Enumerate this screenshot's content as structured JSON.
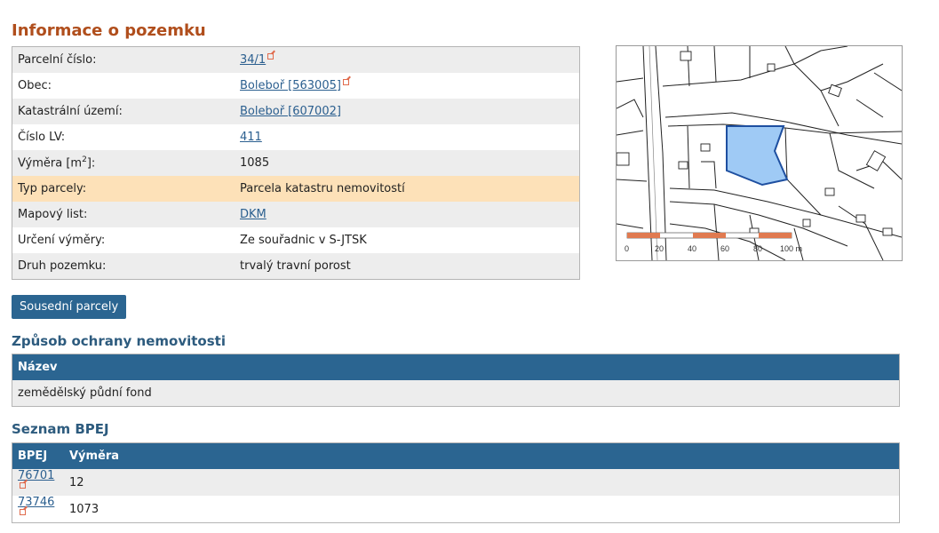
{
  "page": {
    "title": "Informace o pozemku"
  },
  "info_rows": [
    {
      "label": "Parcelní číslo:",
      "value": "34/1",
      "link": true,
      "external": true
    },
    {
      "label": "Obec:",
      "value": "Boleboř [563005]",
      "link": true,
      "external": true
    },
    {
      "label": "Katastrální území:",
      "value": "Boleboř [607002]",
      "link": true,
      "external": false
    },
    {
      "label": "Číslo LV:",
      "value": "411",
      "link": true,
      "external": false
    },
    {
      "label_main": "Výměra [m",
      "label_sup": "2",
      "label_tail": "]:",
      "value": "1085",
      "link": false
    },
    {
      "label": "Typ parcely:",
      "value": "Parcela katastru nemovitostí",
      "link": false,
      "highlight": true
    },
    {
      "label": "Mapový list:",
      "value": "DKM",
      "link": true,
      "external": false
    },
    {
      "label": "Určení výměry:",
      "value": "Ze souřadnic v S-JTSK",
      "link": false
    },
    {
      "label": "Druh pozemku:",
      "value": "trvalý travní porost",
      "link": false
    }
  ],
  "buttons": {
    "neighbors": "Sousední parcely"
  },
  "protection": {
    "title": "Způsob ochrany nemovitosti",
    "header": "Název",
    "rows": [
      "zemědělský půdní fond"
    ]
  },
  "bpej": {
    "title": "Seznam BPEJ",
    "headers": [
      "BPEJ",
      "Výměra"
    ],
    "rows": [
      {
        "code": "76701",
        "area": "12"
      },
      {
        "code": "73746",
        "area": "1073"
      }
    ]
  },
  "map": {
    "scale_labels": [
      "0",
      "20",
      "40",
      "60",
      "80",
      "100 m"
    ],
    "parcel_color": "#9fcaf5",
    "parcel_outline": "#1e4fa0",
    "scale_color": "#e07a50"
  },
  "colors": {
    "title": "#b04e1c",
    "section": "#2d5b7e",
    "header_bg": "#2b6591",
    "highlight_row": "#fde1b8",
    "link": "#2b5f8f"
  }
}
